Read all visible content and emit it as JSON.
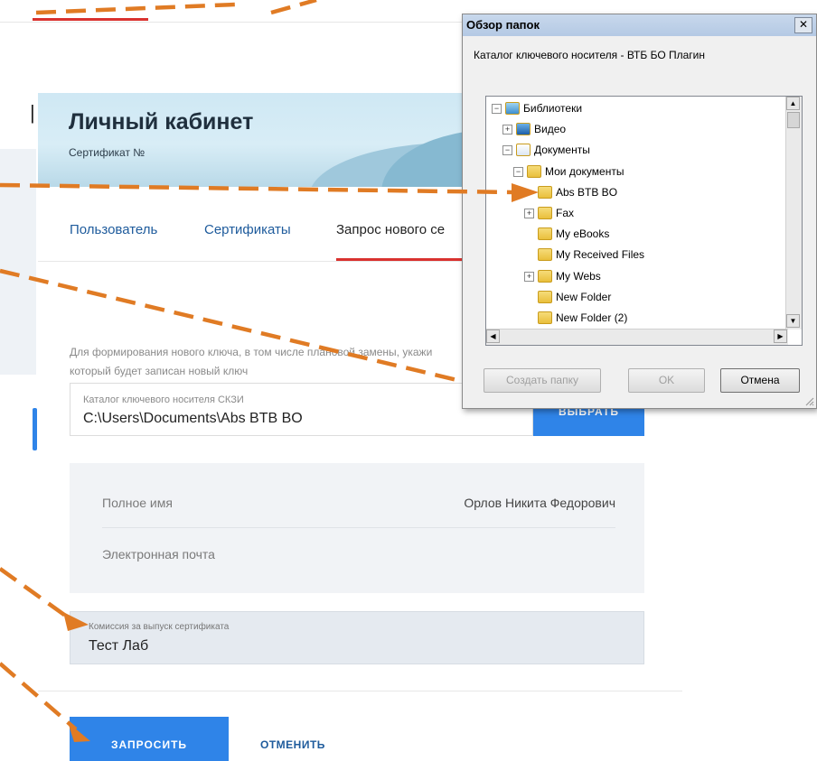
{
  "page": {
    "title": "Личный кабинет",
    "certificate_label": "Сертификат №",
    "tabs": [
      "Пользователь",
      "Сертификаты",
      "Запрос нового се"
    ],
    "info_line1": "Для формирования нового ключа, в том числе плановой замены, укажи",
    "info_line2": "который будет записан новый ключ",
    "key_dir": {
      "label": "Каталог ключевого носителя СКЗИ",
      "value": "C:\\Users\\Documents\\Abs BTB BO",
      "button": "ВЫБРАТЬ"
    },
    "user_info": {
      "full_name_label": "Полное имя",
      "full_name_value": "Орлов Никита Федорович",
      "email_label": "Электронная почта"
    },
    "commission": {
      "label": "Комиссия за выпуск сертификата",
      "value": "Тест Лаб"
    },
    "submit_button": "ЗАПРОСИТЬ",
    "cancel_link": "ОТМЕНИТЬ"
  },
  "dialog": {
    "title": "Обзор папок",
    "close": "✕",
    "description": "Каталог ключевого носителя - ВТБ БО Плагин",
    "tree": [
      {
        "label": "Библиотеки",
        "expander": "⊟",
        "icon": "library-icon"
      },
      {
        "label": "Видео",
        "expander": "⊞",
        "icon": "video-library-icon"
      },
      {
        "label": "Документы",
        "expander": "⊟",
        "icon": "documents-library-icon"
      },
      {
        "label": "Мои документы",
        "expander": "⊟",
        "icon": "my-documents-icon"
      },
      {
        "label": "Abs BTB BO",
        "expander": "",
        "icon": "folder-icon"
      },
      {
        "label": "Fax",
        "expander": "⊞",
        "icon": "folder-icon"
      },
      {
        "label": "My eBooks",
        "expander": "",
        "icon": "folder-icon"
      },
      {
        "label": "My Received Files",
        "expander": "",
        "icon": "folder-icon"
      },
      {
        "label": "My Webs",
        "expander": "⊞",
        "icon": "folder-icon"
      },
      {
        "label": "New Folder",
        "expander": "",
        "icon": "folder-icon"
      },
      {
        "label": "New Folder (2)",
        "expander": "",
        "icon": "folder-icon"
      }
    ],
    "buttons": {
      "create_folder": "Создать папку",
      "ok": "OK",
      "cancel": "Отмена"
    }
  },
  "colors": {
    "accent": "#2f84e8",
    "tab_active_underline": "#d9322f",
    "annotation_arrow": "#e07b24"
  }
}
